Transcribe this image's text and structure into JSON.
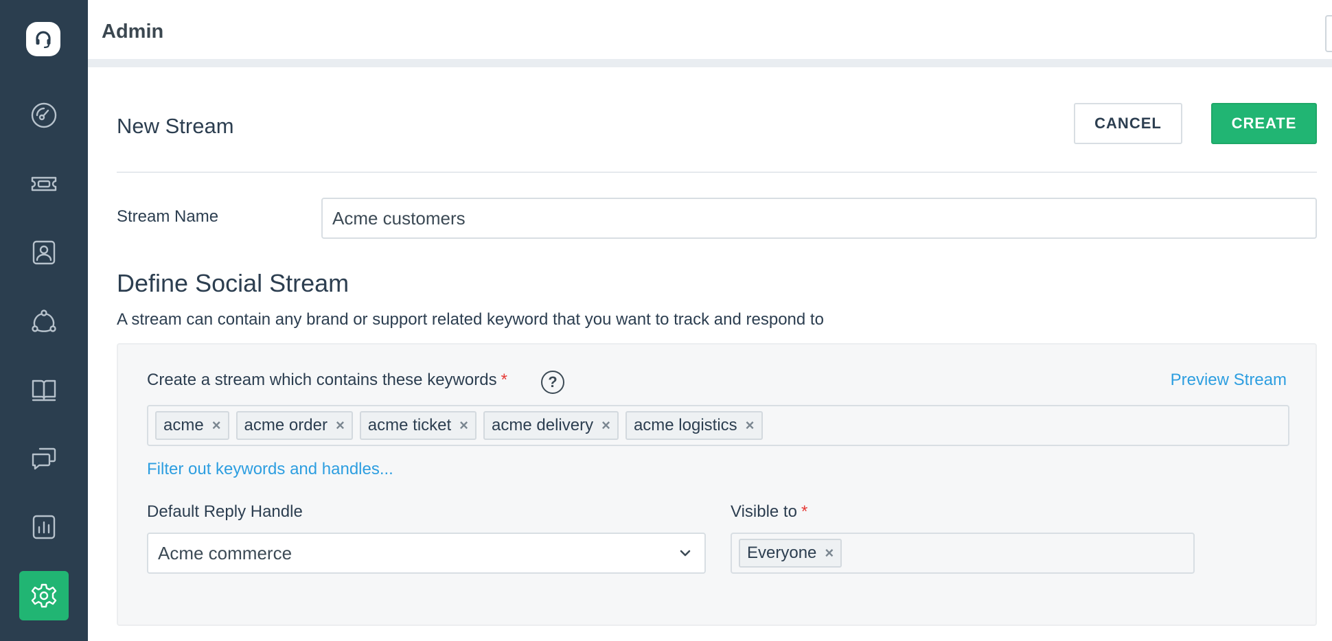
{
  "sidebar": {
    "items": [
      {
        "icon": "dashboard-icon"
      },
      {
        "icon": "ticket-icon"
      },
      {
        "icon": "contact-icon"
      },
      {
        "icon": "social-icon"
      },
      {
        "icon": "book-icon"
      },
      {
        "icon": "chat-icon"
      },
      {
        "icon": "reports-icon"
      },
      {
        "icon": "gear-icon",
        "active": true
      }
    ],
    "accent": "#21b573",
    "background": "#2b3e4f"
  },
  "header": {
    "title": "Admin"
  },
  "page": {
    "title": "New Stream",
    "cancel_label": "CANCEL",
    "create_label": "CREATE"
  },
  "stream_name": {
    "label": "Stream Name",
    "value": "Acme customers"
  },
  "section": {
    "title": "Define Social Stream",
    "description": "A stream can contain any brand or support related keyword that you want to track and respond to"
  },
  "keywords": {
    "label": "Create a stream which contains these keywords",
    "required": "*",
    "help": "?",
    "preview_link": "Preview Stream",
    "tags": [
      "acme",
      "acme order",
      "acme ticket",
      "acme delivery",
      "acme logistics"
    ],
    "remove_symbol": "×",
    "filter_link": "Filter out keywords and handles..."
  },
  "reply_handle": {
    "label": "Default Reply Handle",
    "value": "Acme commerce"
  },
  "visible_to": {
    "label": "Visible to",
    "required": "*",
    "tags": [
      "Everyone"
    ]
  }
}
